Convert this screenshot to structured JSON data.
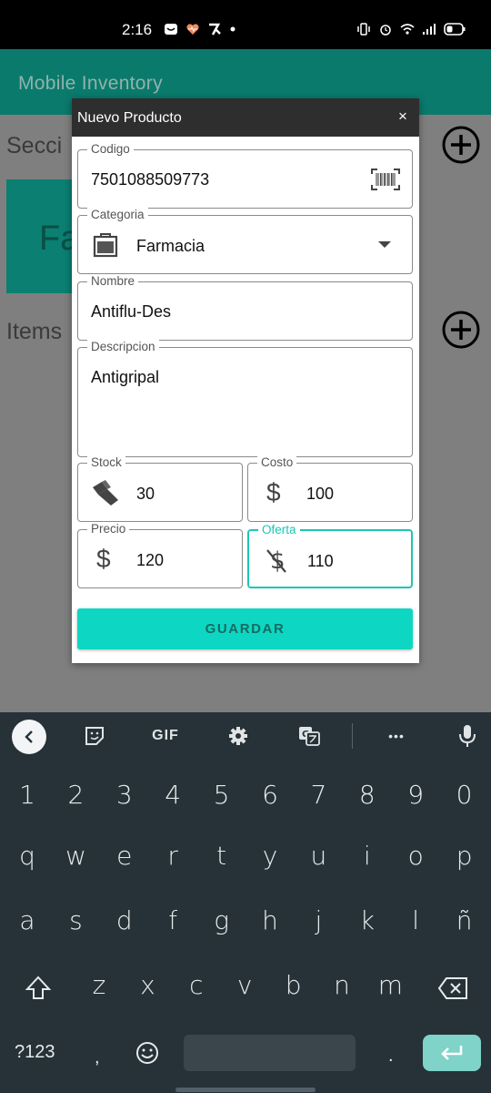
{
  "status_bar": {
    "time": "2:16",
    "left_icons": [
      "notification-square-icon",
      "health-heart-icon",
      "app-logo-icon",
      "dot-icon"
    ],
    "right_icons": [
      "vibrate-icon",
      "alarm-icon",
      "wifi-icon",
      "signal-icon",
      "battery-icon"
    ]
  },
  "app_bar": {
    "title": "Mobile Inventory"
  },
  "background": {
    "sections_label": "Secci",
    "card_letter": "Fa",
    "items_label": "Items"
  },
  "dialog": {
    "title": "Nuevo Producto",
    "close_label": "×",
    "fields": {
      "codigo": {
        "label": "Codigo",
        "value": "7501088509773",
        "icon": "barcode-icon"
      },
      "categoria": {
        "label": "Categoria",
        "value": "Farmacia",
        "icon": "category-box-icon"
      },
      "nombre": {
        "label": "Nombre",
        "value": "Antiflu-Des"
      },
      "descripcion": {
        "label": "Descripcion",
        "value": "Antigripal"
      },
      "stock": {
        "label": "Stock",
        "value": "30",
        "icon": "boxes-icon"
      },
      "costo": {
        "label": "Costo",
        "value": "100",
        "icon": "dollar-icon"
      },
      "precio": {
        "label": "Precio",
        "value": "120",
        "icon": "dollar-icon"
      },
      "oferta": {
        "label": "Oferta",
        "value": "110",
        "icon": "dollar-off-icon"
      }
    },
    "save_label": "GUARDAR"
  },
  "keyboard": {
    "toolbar": [
      "back-icon",
      "sticker-icon",
      "GIF",
      "settings-icon",
      "translate-icon",
      "more-icon",
      "mic-icon"
    ],
    "gif_label": "GIF",
    "more_label": "•••",
    "row_numbers": [
      "1",
      "2",
      "3",
      "4",
      "5",
      "6",
      "7",
      "8",
      "9",
      "0"
    ],
    "row_1": [
      "q",
      "w",
      "e",
      "r",
      "t",
      "y",
      "u",
      "i",
      "o",
      "p"
    ],
    "row_2": [
      "a",
      "s",
      "d",
      "f",
      "g",
      "h",
      "j",
      "k",
      "l",
      "ñ"
    ],
    "row_3": [
      "z",
      "x",
      "c",
      "v",
      "b",
      "n",
      "m"
    ],
    "symbols_label": "?123",
    "comma_label": ",",
    "period_label": "."
  },
  "colors": {
    "accent": "#0dd7c2",
    "focused_border": "#1cc6b4",
    "dialog_header": "#2e2e2e",
    "keyboard_bg": "#263238"
  }
}
